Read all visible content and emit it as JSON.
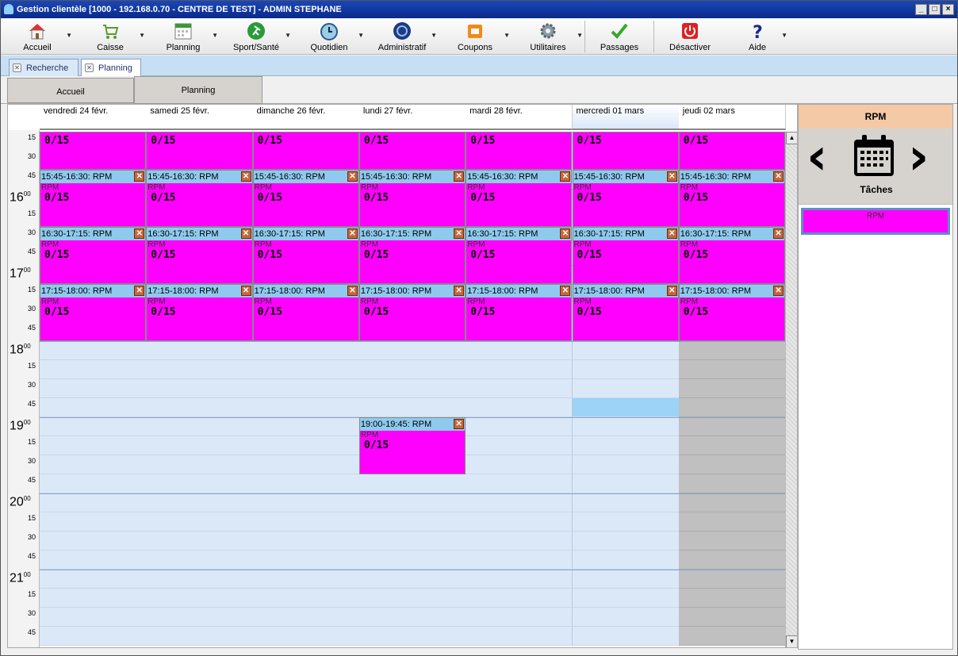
{
  "window": {
    "title": "Gestion clientèle [1000 - 192.168.0.70 - CENTRE DE TEST] - ADMIN STEPHANE"
  },
  "toolbar": [
    {
      "label": "Accueil",
      "icon": "house-icon",
      "dropdown": true
    },
    {
      "label": "Caisse",
      "icon": "cart-icon",
      "dropdown": true
    },
    {
      "label": "Planning",
      "icon": "calendar-icon",
      "dropdown": true
    },
    {
      "label": "Sport/Santé",
      "icon": "runner-icon",
      "dropdown": true
    },
    {
      "label": "Quotidien",
      "icon": "clock-icon",
      "dropdown": true
    },
    {
      "label": "Administratif",
      "icon": "admin-icon",
      "dropdown": true
    },
    {
      "label": "Coupons",
      "icon": "coupon-icon",
      "dropdown": true
    },
    {
      "label": "Utilitaires",
      "icon": "gear-icon",
      "dropdown": true
    },
    {
      "label": "Passages",
      "icon": "checkmark-icon",
      "dropdown": false
    },
    {
      "label": "Désactiver",
      "icon": "power-icon",
      "dropdown": false
    },
    {
      "label": "Aide",
      "icon": "help-icon",
      "dropdown": true
    }
  ],
  "tabs": [
    {
      "label": "Recherche"
    },
    {
      "label": "Planning"
    }
  ],
  "subtabs": [
    {
      "label": "Accueil"
    },
    {
      "label": "Planning"
    }
  ],
  "calendar": {
    "days": [
      "vendredi 24 févr.",
      "samedi 25 févr.",
      "dimanche 26 févr.",
      "lundi 27 févr.",
      "mardi 28 févr.",
      "mercredi 01 mars",
      "jeudi 02 mars"
    ],
    "selected_day": "mercredi 01 mars",
    "hours": [
      "16",
      "17",
      "18",
      "19",
      "20",
      "21"
    ],
    "hour_suffix": "00",
    "minutes": [
      "15",
      "30",
      "45"
    ],
    "event_name": "RPM",
    "capacity": "0/15",
    "slots": [
      "15:45-16:30: RPM",
      "16:30-17:15: RPM",
      "17:15-18:00: RPM"
    ],
    "extra_event": {
      "day": "lundi 27 févr.",
      "label": "19:00-19:45: RPM",
      "name": "RPM",
      "capacity": "0/15"
    },
    "highlighted_cell": {
      "day": "mercredi 01 mars",
      "time": "18:45"
    },
    "unavailable_day": "jeudi 02 mars"
  },
  "side_panel": {
    "title": "RPM",
    "tasks_label": "Tâches",
    "task_item": "RPM"
  },
  "colors": {
    "event": "#ff00ff",
    "event_header": "#8fcaee",
    "cell": "#dbe8f8",
    "unavailable": "#c0c0c0",
    "highlight": "#9cd3f6"
  }
}
